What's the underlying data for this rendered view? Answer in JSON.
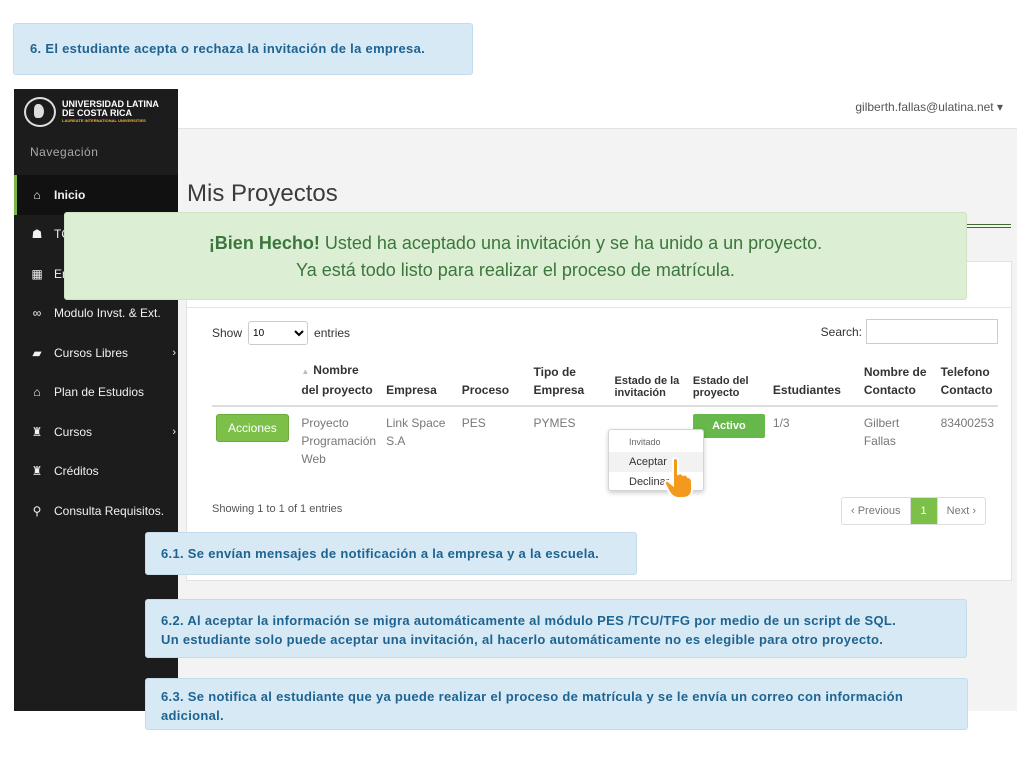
{
  "notes": {
    "top": "6. El estudiante acepta o rechaza la invitación de la empresa.",
    "n1": "6.1. Se envían mensajes de notificación a la empresa y a la escuela.",
    "n2_line1": "6.2. Al aceptar la información se migra automáticamente al módulo PES /TCU/TFG por medio de un script de SQL.",
    "n2_line2": "Un estudiante solo puede aceptar una invitación, al hacerlo automáticamente no es elegible para otro proyecto.",
    "n3_line1": "6.3. Se notifica al estudiante que ya puede realizar el proceso de matrícula y se le envía un correo con información",
    "n3_line2": "adicional."
  },
  "logo": {
    "line1": "UNIVERSIDAD LATINA",
    "line2": "DE COSTA RICA",
    "line3": "LAUREATE INTERNATIONAL UNIVERSITIES"
  },
  "sidebar": {
    "title": "Navegación",
    "items": [
      {
        "icon": "home-icon",
        "glyph": "⌂",
        "label": "Inicio"
      },
      {
        "icon": "graduation-icon",
        "glyph": "☗",
        "label": "TCU"
      },
      {
        "icon": "building-icon",
        "glyph": "▦",
        "label": "Emp"
      },
      {
        "icon": "glasses-icon",
        "glyph": "∞",
        "label": "Modulo Invst. & Ext."
      },
      {
        "icon": "book-icon",
        "glyph": "▰",
        "label": "Cursos Libres"
      },
      {
        "icon": "bank-icon",
        "glyph": "⌂",
        "label": "Plan de Estudios"
      },
      {
        "icon": "trophy-icon",
        "glyph": "♜",
        "label": "Cursos"
      },
      {
        "icon": "trophy-icon",
        "glyph": "♜",
        "label": "Créditos"
      },
      {
        "icon": "search-icon",
        "glyph": "⚲",
        "label": "Consulta Requisitos."
      }
    ]
  },
  "header": {
    "user": "gilberth.fallas@ulatina.net",
    "caret": "▾"
  },
  "page": {
    "title": "Mis Proyectos"
  },
  "alert": {
    "strong": "¡Bien Hecho!",
    "text1": "Usted ha aceptado una invitación y se ha unido a un proyecto.",
    "text2": "Ya está todo listo para realizar el proceso de matrícula."
  },
  "table_controls": {
    "show": "Show",
    "entries_value": "10",
    "entries": "entries",
    "search": "Search:"
  },
  "table": {
    "headers": [
      "",
      "Nombre del proyecto",
      "Empresa",
      "Proceso",
      "Tipo de Empresa",
      "Estado de la invitación",
      "Estado del proyecto",
      "Estudiantes",
      "Nombre de Contacto",
      "Telefono Contacto"
    ],
    "row": {
      "action": "Acciones",
      "proyecto": "Proyecto Programación Web",
      "empresa": "Link Space S.A",
      "proceso": "PES",
      "tipo": "PYMES",
      "estado_proyecto": "Activo",
      "estudiantes": "1/3",
      "contacto": "Gilbert Fallas",
      "telefono": "83400253"
    }
  },
  "dropdown": {
    "header": "Invitado",
    "accept": "Aceptar",
    "decline": "Declinar"
  },
  "footer": {
    "showing": "Showing 1 to 1 of 1 entries",
    "previous": "Previous",
    "page": "1",
    "next": "Next"
  },
  "colors": {
    "sidebar": "#1c1c1c",
    "accent": "#7cc04a",
    "alert_bg": "#dcefd4",
    "note_bg": "#d6e9f5"
  }
}
